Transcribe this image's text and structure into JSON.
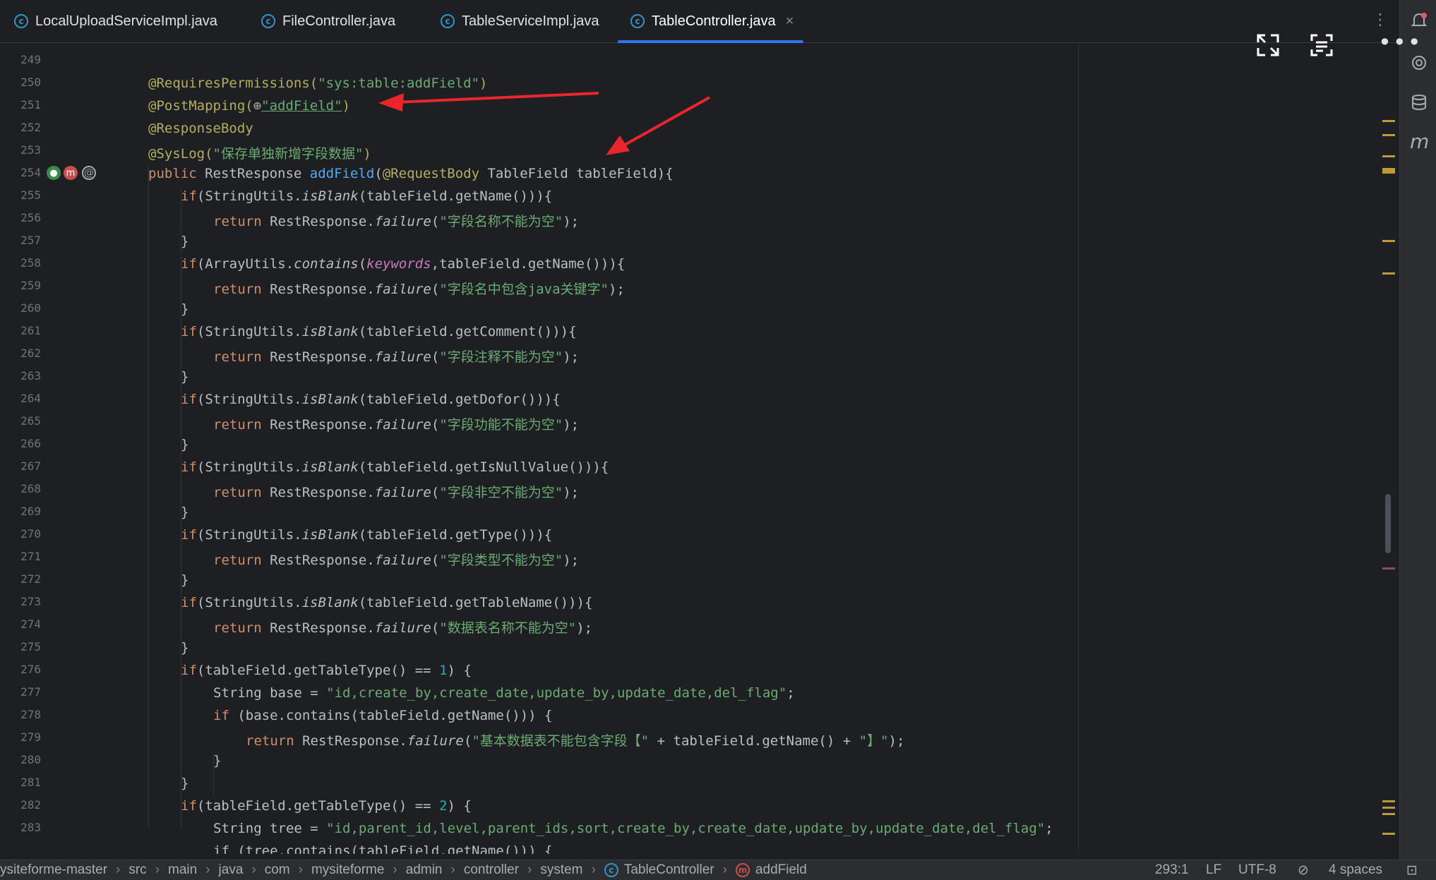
{
  "tabs": [
    {
      "label": "LocalUploadServiceImpl.java",
      "icon": "class-icon",
      "active": false
    },
    {
      "label": "FileController.java",
      "icon": "class-icon",
      "active": false
    },
    {
      "label": "TableServiceImpl.java",
      "icon": "class-icon",
      "active": false
    },
    {
      "label": "TableController.java",
      "icon": "class-icon",
      "active": true,
      "close": "×"
    }
  ],
  "line_numbers": [
    "249",
    "250",
    "251",
    "252",
    "253",
    "254",
    "255",
    "256",
    "257",
    "258",
    "259",
    "260",
    "261",
    "262",
    "263",
    "264",
    "265",
    "266",
    "267",
    "268",
    "269",
    "270",
    "271",
    "272",
    "273",
    "274",
    "275",
    "276",
    "277",
    "278",
    "279",
    "280",
    "281",
    "282",
    "283"
  ],
  "code": {
    "l250_ann": "@RequiresPermissions(",
    "l250_str": "\"sys:table:addField\"",
    "l250_end": ")",
    "l251_ann": "@PostMapping(",
    "l251_globe": "⊕",
    "l251_str": "\"addField\"",
    "l251_end": ")",
    "l252_ann": "@ResponseBody",
    "l253_ann": "@SysLog(",
    "l253_str": "\"保存单独新增字段数据\"",
    "l253_end": ")",
    "l254_kw": "public ",
    "l254_type": "RestResponse ",
    "l254_fn": "addField",
    "l254_p1": "(",
    "l254_ann": "@RequestBody",
    "l254_rest": " TableField tableField){",
    "if_kw": "if",
    "return_kw": "return ",
    "rr": "RestResponse.",
    "failure": "failure",
    "close_brace": "}",
    "l255_a": "(StringUtils.",
    "l255_b": "isBlank",
    "l255_c": "(tableField.getName())){",
    "l256_str": "\"字段名称不能为空\"",
    "l258_a": "(ArrayUtils.",
    "l258_b": "contains",
    "l258_c": "(",
    "l258_d": "keywords",
    "l258_e": ",tableField.getName())){",
    "l259_str": "\"字段名中包含java关键字\"",
    "l261_c": "(tableField.getComment())){",
    "l262_str": "\"字段注释不能为空\"",
    "l264_c": "(tableField.getDofor())){",
    "l265_str": "\"字段功能不能为空\"",
    "l267_c": "(tableField.getIsNullValue())){",
    "l268_str": "\"字段非空不能为空\"",
    "l270_c": "(tableField.getType())){",
    "l271_str": "\"字段类型不能为空\"",
    "l273_c": "(tableField.getTableName())){",
    "l274_str": "\"数据表名称不能为空\"",
    "l276_a": "(tableField.getTableType() == ",
    "l276_num": "1",
    "l276_b": ") {",
    "l277_a": "String base = ",
    "l277_str": "\"id,create_by,create_date,update_by,update_date,del_flag\"",
    "l277_b": ";",
    "l278_kw": "if ",
    "l278_a": "(base.contains(tableField.getName())) {",
    "l279_str1": "\"基本数据表不能包含字段【\"",
    "l279_mid": " + tableField.getName() + ",
    "l279_str2": "\"】\"",
    "l279_end": ");",
    "l282_a": "(tableField.getTableType() == ",
    "l282_num": "2",
    "l282_b": ") {",
    "l283_a": "String tree = ",
    "l283_str": "\"id,parent_id,level,parent_ids,sort,create_by,create_date,update_by,update_date,del_flag\"",
    "l283_b": ";",
    "l284_partial": "if (tree.contains(tableField.getName())) {",
    "semi_end": ");"
  },
  "breadcrumb": [
    "ysiteforme-master",
    "src",
    "main",
    "java",
    "com",
    "mysiteforme",
    "admin",
    "controller",
    "system",
    "TableController",
    "addField"
  ],
  "breadcrumb_sep": "›",
  "status": {
    "position": "293:1",
    "line_sep": "LF",
    "encoding": "UTF-8",
    "indent": "4 spaces"
  },
  "icons": {
    "bell": "notification-bell-icon",
    "ai": "ai-assistant-icon",
    "database": "database-icon",
    "maven": "maven-icon",
    "expand": "expand-icon",
    "scan": "scan-text-icon",
    "more": "more-icon"
  },
  "colors": {
    "accent": "#3574f0",
    "annotation": "#b3ae60",
    "string": "#6aab73",
    "keyword": "#cf8e6d",
    "arrow": "#e8262b"
  }
}
